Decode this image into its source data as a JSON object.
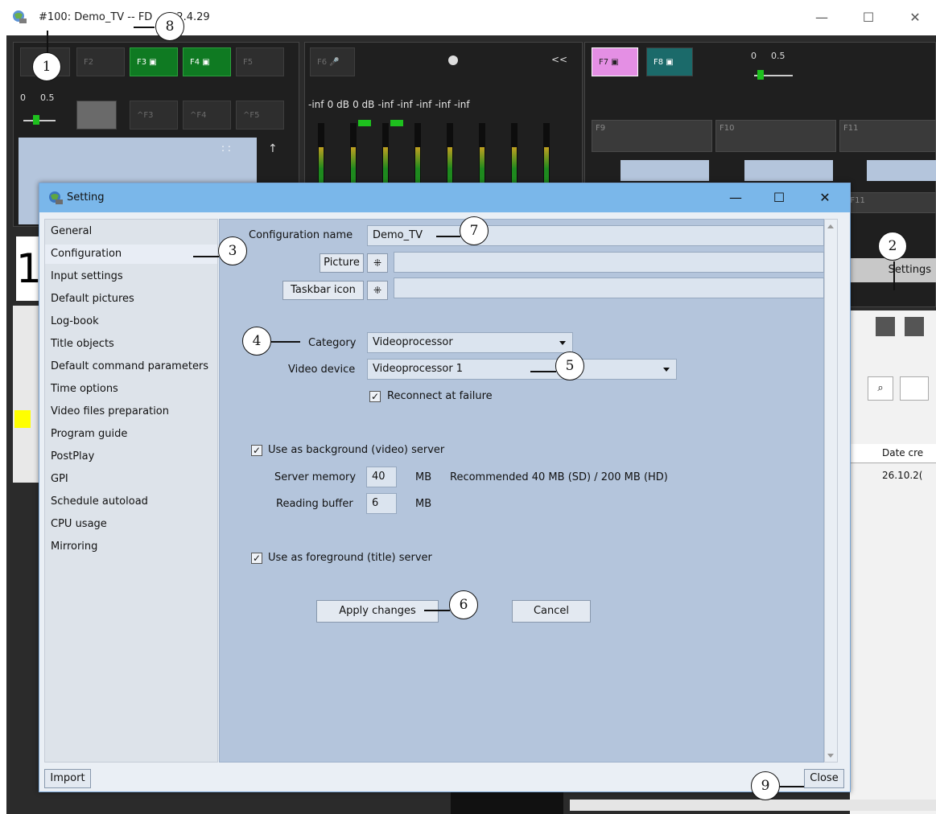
{
  "main_window": {
    "title": "#100: Demo_TV -- FD",
    "title_version": "2.4.29",
    "controls": {
      "minimize": "—",
      "maximize": "☐",
      "close": "✕"
    }
  },
  "app": {
    "fkeys_row1": [
      "F2",
      "F3",
      "F4",
      "F5"
    ],
    "fkeys_row2": [
      "^F3",
      "^F4",
      "^F5"
    ],
    "f6": "F6",
    "collapse": "<<",
    "f7": "F7",
    "f8": "F8",
    "slider_left": {
      "min": "0",
      "max": "0.5"
    },
    "slider_right": {
      "min": "0",
      "max": "0.5"
    },
    "meter_levels": [
      "-inf",
      "0 dB",
      "0 dB",
      "-inf",
      "-inf",
      "-inf",
      "-inf",
      "-inf"
    ],
    "cells": [
      "F9",
      "F10",
      "F11"
    ],
    "cell_f11b": "^F11",
    "colon": ": :",
    "big_digit": "1",
    "settings_button": "Settings",
    "table_header": "Date cre",
    "table_cell": "26.10.2("
  },
  "dialog": {
    "title": "Setting",
    "controls": {
      "minimize": "—",
      "maximize": "☐",
      "close": "✕"
    },
    "nav_items": [
      "General",
      "Configuration",
      "Input settings",
      "Default pictures",
      "Log-book",
      "Title objects",
      "Default command parameters",
      "Time options",
      "Video files preparation",
      "Program guide",
      "PostPlay",
      "GPI",
      "Schedule autoload",
      "CPU usage",
      "Mirroring"
    ],
    "selected_nav": "Configuration",
    "config_name_label": "Configuration name",
    "config_name_value": "Demo_TV",
    "picture_button": "Picture",
    "taskbar_icon_button": "Taskbar icon",
    "category_label": "Category",
    "category_value": "Videoprocessor",
    "video_device_label": "Video device",
    "video_device_value": "Videoprocessor 1",
    "reconnect_label": "Reconnect at failure",
    "reconnect_checked": true,
    "background_label": "Use as background (video) server",
    "background_checked": true,
    "server_memory_label": "Server memory",
    "server_memory_value": "40",
    "server_memory_unit": "MB",
    "recommended_text": "Recommended 40 MB (SD) / 200 MB (HD)",
    "reading_buffer_label": "Reading buffer",
    "reading_buffer_value": "6",
    "reading_buffer_unit": "MB",
    "foreground_label": "Use as foreground (title) server",
    "foreground_checked": true,
    "apply_button": "Apply changes",
    "cancel_button": "Cancel",
    "import_button": "Import",
    "close_button": "Close"
  },
  "callouts": [
    "1",
    "2",
    "3",
    "4",
    "5",
    "6",
    "7",
    "8",
    "9"
  ]
}
